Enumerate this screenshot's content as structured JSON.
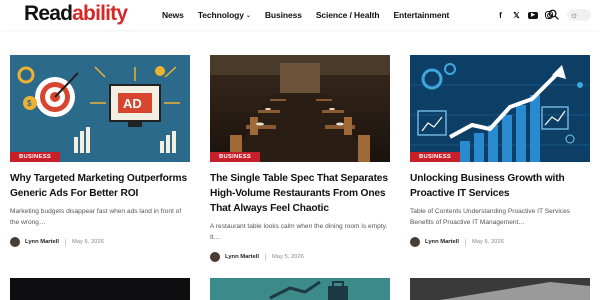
{
  "header": {
    "logo_part1": "Read",
    "logo_part2": "ability",
    "nav": [
      {
        "label": "News"
      },
      {
        "label": "Technology"
      },
      {
        "label": "Business"
      },
      {
        "label": "Science / Health"
      },
      {
        "label": "Entertainment"
      }
    ],
    "socials": [
      "facebook-icon",
      "x-icon",
      "youtube-icon",
      "instagram-icon"
    ],
    "colors": {
      "brand_red": "#d42a2a",
      "badge_red": "#c8202a"
    }
  },
  "cards": [
    {
      "badge": "BUSINESS",
      "title": "Why Targeted Marketing Outperforms Generic Ads For Better ROI",
      "excerpt": "Marketing budgets disappear fast when ads land in front of the wrong…",
      "author": "Lynn Martell",
      "date": "May 5, 2026",
      "image_label": "AD"
    },
    {
      "badge": "BUSINESS",
      "title": "The Single Table Spec That Separates High-Volume Restaurants From Ones That Always Feel Chaotic",
      "excerpt": "A restaurant table looks calm when the dining room is empty. It…",
      "author": "Lynn Martell",
      "date": "May 5, 2026"
    },
    {
      "badge": "BUSINESS",
      "title": "Unlocking Business Growth with Proactive IT Services",
      "excerpt": "Table of Contents Understanding Proactive IT Services Benefits of Proactive IT Management…",
      "author": "Lynn Martell",
      "date": "May 5, 2026"
    }
  ]
}
